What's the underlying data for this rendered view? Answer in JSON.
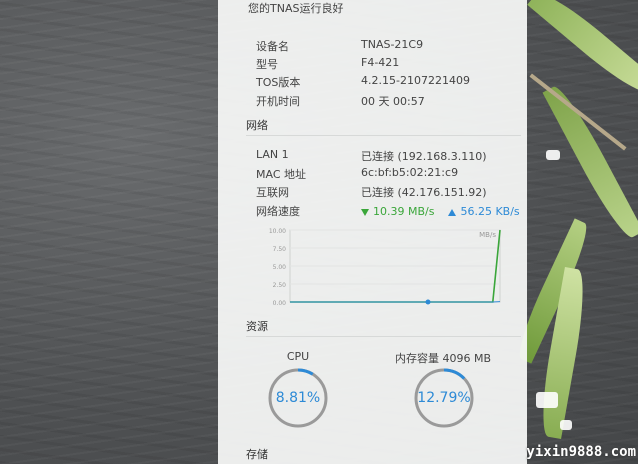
{
  "header": {
    "status_text": "您的TNAS运行良好"
  },
  "device": {
    "rows": [
      {
        "label": "设备名",
        "value": "TNAS-21C9"
      },
      {
        "label": "型号",
        "value": "F4-421"
      },
      {
        "label": "TOS版本",
        "value": "4.2.15-2107221409"
      },
      {
        "label": "开机时间",
        "value": "00 天 00:57"
      }
    ]
  },
  "network": {
    "title": "网络",
    "rows": [
      {
        "label": "LAN 1",
        "value": "已连接 (192.168.3.110)"
      },
      {
        "label": "MAC 地址",
        "value": "6c:bf:b5:02:21:c9"
      },
      {
        "label": "互联网",
        "value": "已连接 (42.176.151.92)"
      }
    ],
    "speed_label": "网络速度",
    "download": "10.39 MB/s",
    "upload": "56.25 KB/s"
  },
  "chart_data": {
    "type": "line",
    "unit_label": "MB/s",
    "y_ticks": [
      "10.00",
      "7.50",
      "5.00",
      "2.50",
      "0.00"
    ],
    "ylim": [
      0,
      10
    ],
    "grid": true,
    "series": [
      {
        "values": [
          0,
          0,
          0,
          0,
          0,
          0,
          0,
          0,
          0,
          0,
          0,
          0,
          0,
          0,
          0,
          0,
          0,
          0,
          0,
          0,
          0,
          0,
          0,
          0,
          0,
          0,
          0,
          0,
          0,
          10.39
        ],
        "color": "#3aa63a"
      },
      {
        "values": [
          0,
          0,
          0,
          0,
          0,
          0,
          0,
          0,
          0,
          0,
          0,
          0,
          0,
          0,
          0,
          0,
          0,
          0,
          0,
          0,
          0,
          0,
          0,
          0,
          0,
          0,
          0,
          0,
          0,
          0.05
        ],
        "color": "#2d8ad6"
      }
    ]
  },
  "resources": {
    "title": "资源",
    "cpu": {
      "label": "CPU",
      "value": "8.81%",
      "fraction": 0.0881
    },
    "memory": {
      "label": "内存容量 4096 MB",
      "value": "12.79%",
      "fraction": 0.1279
    }
  },
  "storage": {
    "title": "存储"
  },
  "watermark": "yixin9888.com",
  "colors": {
    "accent_blue": "#2d8ad6",
    "accent_green": "#3aa63a",
    "gauge_track": "#9a9a9a"
  }
}
